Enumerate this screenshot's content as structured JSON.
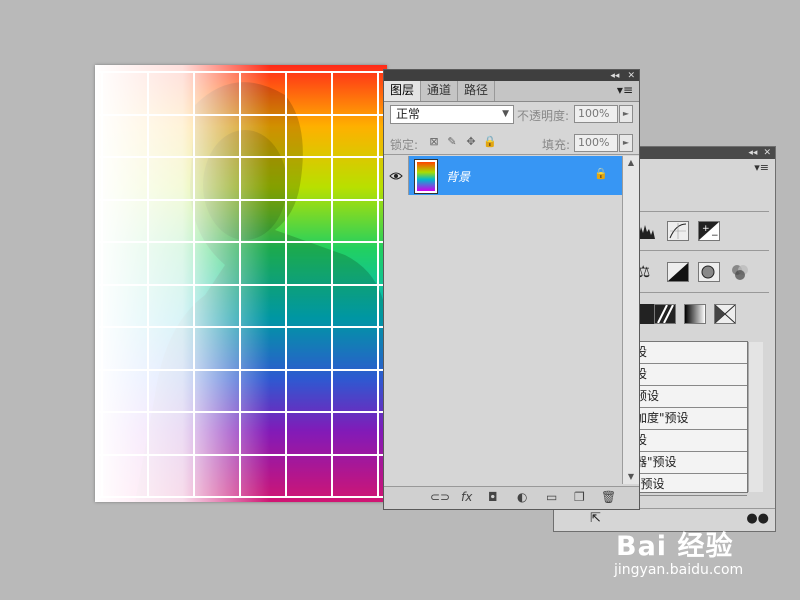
{
  "document": {
    "grid_cols": 6,
    "grid_rows": 10
  },
  "layers_panel": {
    "tabs": [
      "图层",
      "通道",
      "路径"
    ],
    "active_tab": 0,
    "tab_menu_icon": "panel-menu-icon",
    "blend_mode": "正常",
    "opacity_label": "不透明度:",
    "opacity_value": "100%",
    "lock_label": "锁定:",
    "lock_icons": [
      "lock-transparent-icon",
      "lock-paint-icon",
      "lock-move-icon",
      "lock-all-icon"
    ],
    "fill_label": "填充:",
    "fill_value": "100%",
    "layers": [
      {
        "name": "背景",
        "visible": true,
        "locked": true,
        "selected": true
      }
    ],
    "footer_icons": [
      "link-layers-icon",
      "fx-style-icon",
      "add-mask-icon",
      "adjustment-layer-icon",
      "new-group-icon",
      "new-layer-icon",
      "trash-icon"
    ],
    "footer_fx_label": "fx"
  },
  "adjustments_panel": {
    "presets": [
      "设",
      "设",
      "预设",
      "加度\"预设",
      "设",
      "器\"预设",
      "\"预设"
    ]
  },
  "watermark": {
    "brand": "Bai 经验",
    "url": "jingyan.baidu.com"
  },
  "colors": {
    "workspace": "#b9b9b9",
    "panel": "#d6d6d6",
    "selection": "#3796f4",
    "titlebar": "#3f3f3f"
  }
}
